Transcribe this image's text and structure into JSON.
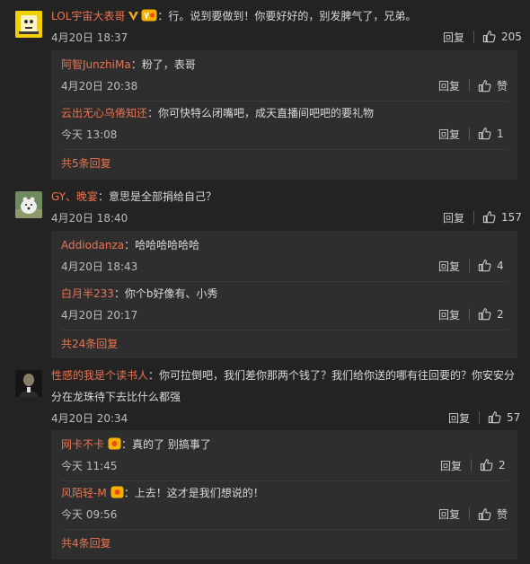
{
  "comments": [
    {
      "user": "LOL宇宙大表哥",
      "text": "：行。说到要做到！你要好好的，别发脾气了，兄弟。",
      "time": "4月20日 18:37",
      "reply": "回复",
      "likes": "205",
      "replies": [
        {
          "user": "阿智JunzhiMa",
          "text": "：粉了，表哥",
          "time": "4月20日 20:38",
          "reply": "回复",
          "likes": "赞"
        },
        {
          "user": "云出无心乌倦知还",
          "text": "：你可快特么闭嘴吧，成天直播间吧吧的要礼物",
          "time": "今天 13:08",
          "reply": "回复",
          "likes": "1"
        }
      ],
      "more": "共5条回复"
    },
    {
      "user": "GY、晚宴",
      "text": "：意思是全部捐给自己？",
      "time": "4月20日 18:40",
      "reply": "回复",
      "likes": "157",
      "replies": [
        {
          "user": "Addiodanza",
          "text": "：哈哈哈哈哈哈",
          "time": "4月20日 18:43",
          "reply": "回复",
          "likes": "4"
        },
        {
          "user": "白月半233",
          "text": "：你个b好像有、小秀",
          "time": "4月20日 20:17",
          "reply": "回复",
          "likes": "2"
        }
      ],
      "more": "共24条回复"
    },
    {
      "user": "性感的我是个读书人",
      "text_line1": "：你可拉倒吧，我们差你那两个钱了？我们给你送的哪有往回要的？你安安分",
      "text_line2": "分在龙珠待下去比什么都强",
      "time": "4月20日 20:34",
      "reply": "回复",
      "likes": "57",
      "replies": [
        {
          "user": "网卡不卡",
          "text": "：真的了 别搞事了",
          "time": "今天 11:45",
          "reply": "回复",
          "likes": "2"
        },
        {
          "user": "风陌轻-M",
          "text": "：上去！这才是我们想说的！",
          "time": "今天 09:56",
          "reply": "回复",
          "likes": "赞"
        }
      ],
      "more": "共4条回复"
    }
  ],
  "colors": {
    "username": "#eb7350",
    "background": "#232323",
    "reply_box": "#2e2e2e"
  },
  "icons": {
    "like": "thumbs-up-icon",
    "verified": "verified-v-icon",
    "vip": "vip-badge-icon"
  }
}
